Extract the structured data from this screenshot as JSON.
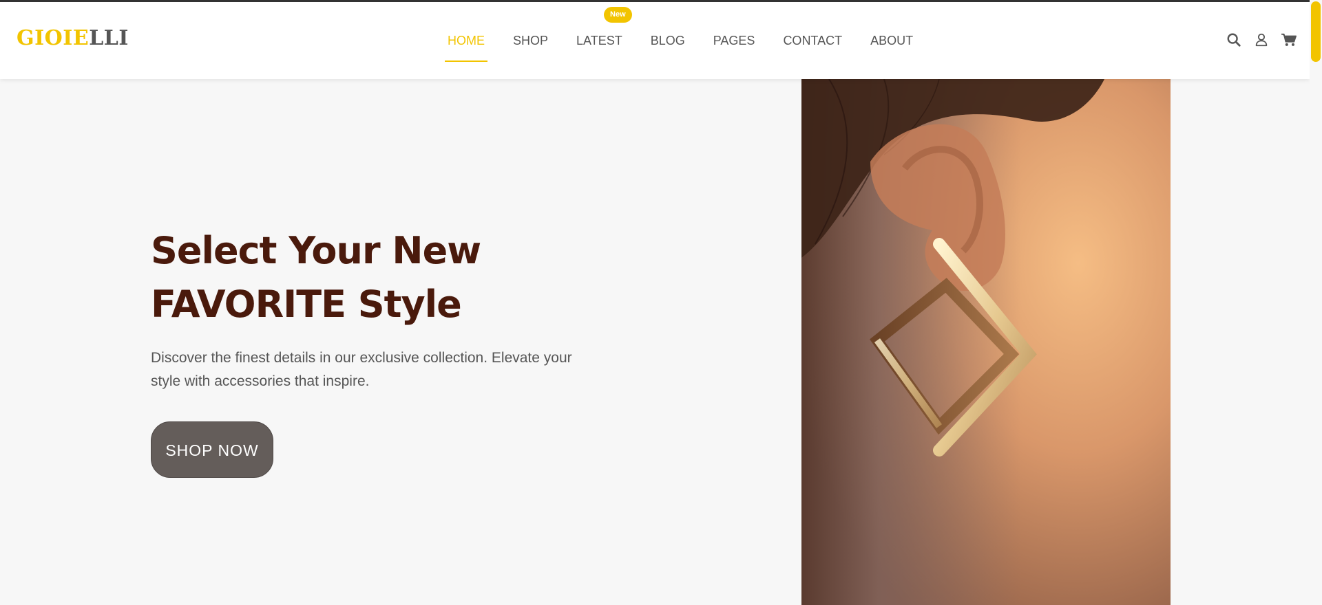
{
  "brand": {
    "part1": "GIOIE",
    "part2": "LLI"
  },
  "nav": {
    "items": [
      {
        "label": "HOME"
      },
      {
        "label": "SHOP"
      },
      {
        "label": "LATEST"
      },
      {
        "label": "BLOG"
      },
      {
        "label": "PAGES"
      },
      {
        "label": "CONTACT"
      },
      {
        "label": "ABOUT"
      }
    ],
    "active": "HOME",
    "badge": "New"
  },
  "header_icons": [
    "search-icon",
    "user-icon",
    "cart-icon"
  ],
  "hero": {
    "title_line1": "Select Your New",
    "title_line2": "FAVORITE Style",
    "subtitle_line1": "Discover the finest details in our exclusive collection. Elevate your",
    "subtitle_line2": "style with accessories that inspire.",
    "cta": "SHOP NOW"
  },
  "colors": {
    "accent": "#f2c400",
    "title": "#4a1a0c",
    "button": "#645d5a",
    "background": "#f7f7f7"
  }
}
